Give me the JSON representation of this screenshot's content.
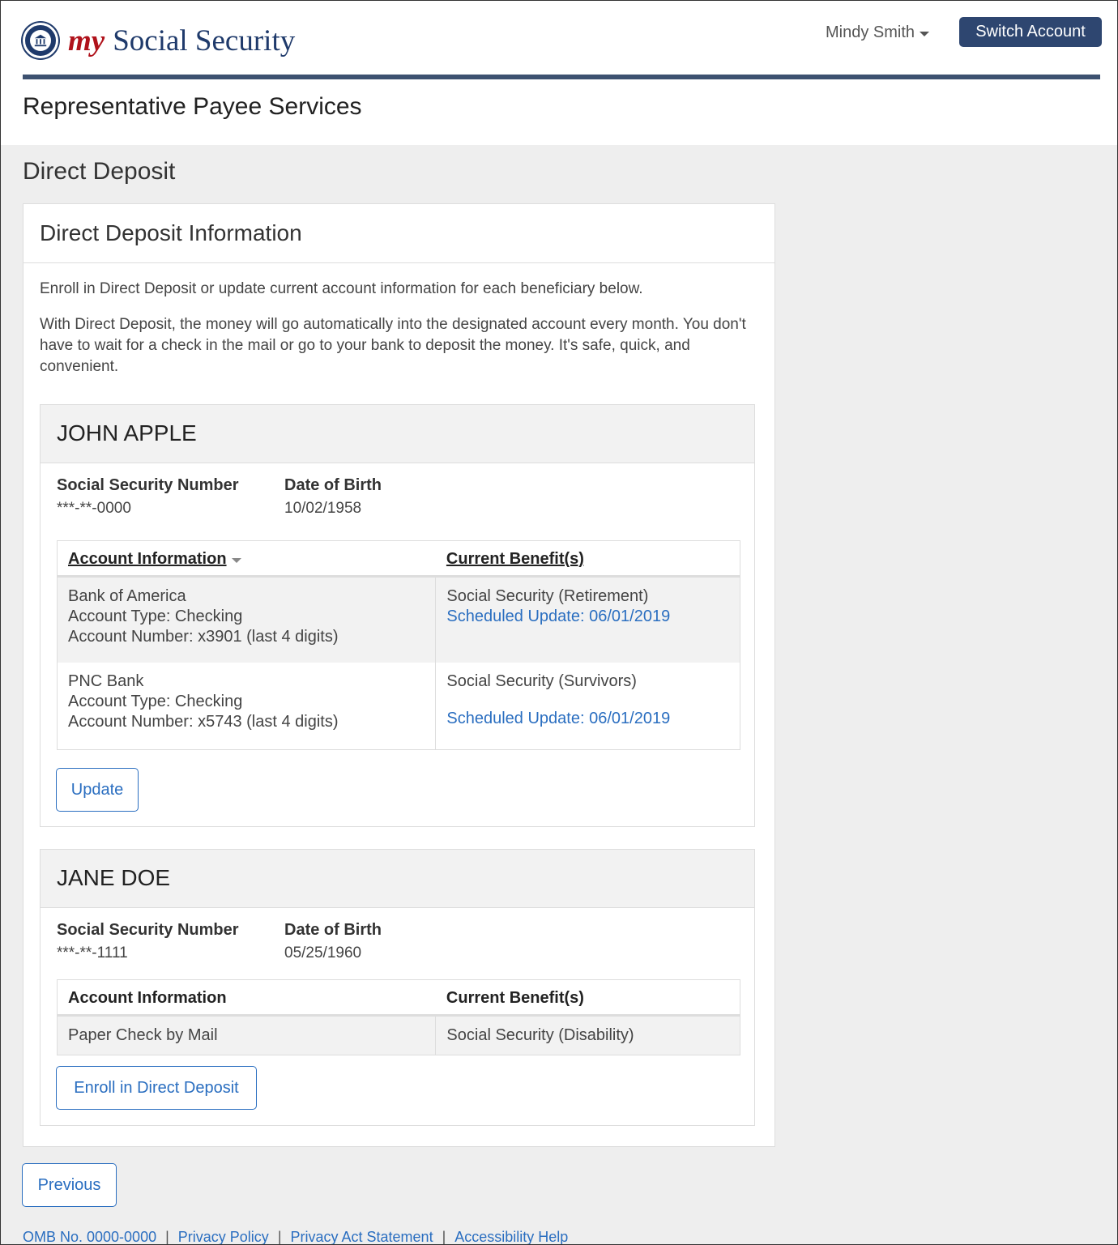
{
  "header": {
    "brand_my": "my",
    "brand_rest": "Social Security",
    "user_name": "Mindy Smith",
    "switch_account": "Switch Account",
    "service_title": "Representative Payee Services"
  },
  "page": {
    "heading": "Direct Deposit",
    "panel_title": "Direct Deposit Information",
    "intro_1": "Enroll in Direct Deposit or update current account information for each beneficiary below.",
    "intro_2": "With Direct Deposit, the money will go automatically into the designated account every month. You don't have to wait for a check in the mail or go to your bank to deposit the money. It's safe, quick, and convenient."
  },
  "beneficiaries": [
    {
      "name": "JOHN APPLE",
      "ssn_label": "Social Security Number",
      "ssn": "***-**-0000",
      "dob_label": "Date of Birth",
      "dob": "10/02/1958",
      "col_account": "Account Information",
      "col_benefit": "Current Benefit(s)",
      "rows": [
        {
          "bank": "Bank of America",
          "type": "Account Type: Checking",
          "number": "Account Number: x3901 (last 4 digits)",
          "benefit": "Social Security (Retirement)",
          "update": "Scheduled Update: 06/01/2019"
        },
        {
          "bank": "PNC Bank",
          "type": "Account Type: Checking",
          "number": "Account Number: x5743 (last 4 digits)",
          "benefit": "Social Security (Survivors)",
          "update": "Scheduled Update: 06/01/2019"
        }
      ],
      "button": "Update"
    },
    {
      "name": "JANE DOE",
      "ssn_label": "Social Security Number",
      "ssn": "***-**-1111",
      "dob_label": "Date of Birth",
      "dob": "05/25/1960",
      "col_account": "Account Information",
      "col_benefit": "Current Benefit(s)",
      "rows": [
        {
          "account": "Paper Check by Mail",
          "benefit": "Social Security (Disability)"
        }
      ],
      "button": "Enroll in Direct Deposit"
    }
  ],
  "nav": {
    "previous": "Previous"
  },
  "footer": {
    "omb": "OMB No. 0000-0000",
    "privacy_policy": "Privacy Policy",
    "privacy_act": "Privacy Act Statement",
    "accessibility": "Accessibility Help",
    "separator": "|"
  },
  "icons": {
    "seal": "ssa-seal-icon",
    "user_menu": "caret-down-icon",
    "sort": "caret-down-icon"
  },
  "colors": {
    "brand_navy": "#1f3a6b",
    "brand_red": "#b0121b",
    "link_blue": "#2a6ec0",
    "button_navy": "#2e4670"
  }
}
